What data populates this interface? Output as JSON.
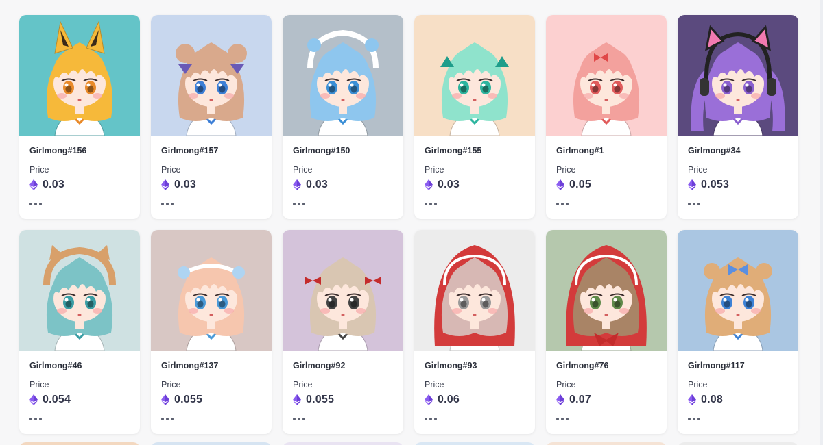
{
  "price_label": "Price",
  "currency_icon": "ethereum-icon",
  "items": [
    {
      "name": "Girlmong#156",
      "price": "0.03",
      "bg": "#64c4c8",
      "hair": "#f6b93a",
      "eyes": "#e98a2a",
      "accessory": "cat-ears"
    },
    {
      "name": "Girlmong#157",
      "price": "0.03",
      "bg": "#c8d7ee",
      "hair": "#d9a98c",
      "eyes": "#3d7fd6",
      "accessory": "buns"
    },
    {
      "name": "Girlmong#150",
      "price": "0.03",
      "bg": "#b4bfc9",
      "hair": "#8ec6ee",
      "eyes": "#3b8fd6",
      "accessory": "bonnet"
    },
    {
      "name": "Girlmong#155",
      "price": "0.03",
      "bg": "#f7dfc6",
      "hair": "#8fe3cc",
      "eyes": "#2eb59f",
      "accessory": "ribbon"
    },
    {
      "name": "Girlmong#1",
      "price": "0.05",
      "bg": "#fcd0d0",
      "hair": "#f3a19d",
      "eyes": "#e05b5b",
      "accessory": "bow"
    },
    {
      "name": "Girlmong#34",
      "price": "0.053",
      "bg": "#5b4a7e",
      "hair": "#9a6fd8",
      "eyes": "#8a5fcf",
      "accessory": "headphones"
    },
    {
      "name": "Girlmong#46",
      "price": "0.054",
      "bg": "#cfe1e2",
      "hair": "#7cc3c6",
      "eyes": "#3a9ea5",
      "accessory": "animal-hood"
    },
    {
      "name": "Girlmong#137",
      "price": "0.055",
      "bg": "#d8c7c4",
      "hair": "#f6c6ae",
      "eyes": "#4a9ad8",
      "accessory": "headband"
    },
    {
      "name": "Girlmong#92",
      "price": "0.055",
      "bg": "#d4c3da",
      "hair": "#d9c6b2",
      "eyes": "#444444",
      "accessory": "red-bows"
    },
    {
      "name": "Girlmong#93",
      "price": "0.06",
      "bg": "#ececec",
      "hair": "#d7b8b4",
      "eyes": "#9a9a9a",
      "accessory": "red-hood"
    },
    {
      "name": "Girlmong#76",
      "price": "0.07",
      "bg": "#b5c8ad",
      "hair": "#a98466",
      "eyes": "#5f8a4a",
      "accessory": "red-cloak"
    },
    {
      "name": "Girlmong#117",
      "price": "0.08",
      "bg": "#aac6e2",
      "hair": "#e0ad78",
      "eyes": "#3d82d6",
      "accessory": "blue-bow"
    }
  ],
  "peek_colors": [
    "#f3d8c0",
    "#d6e4f2",
    "#e9e3f2",
    "#d9e7f4",
    "#f5e3d5",
    "#ececec"
  ]
}
